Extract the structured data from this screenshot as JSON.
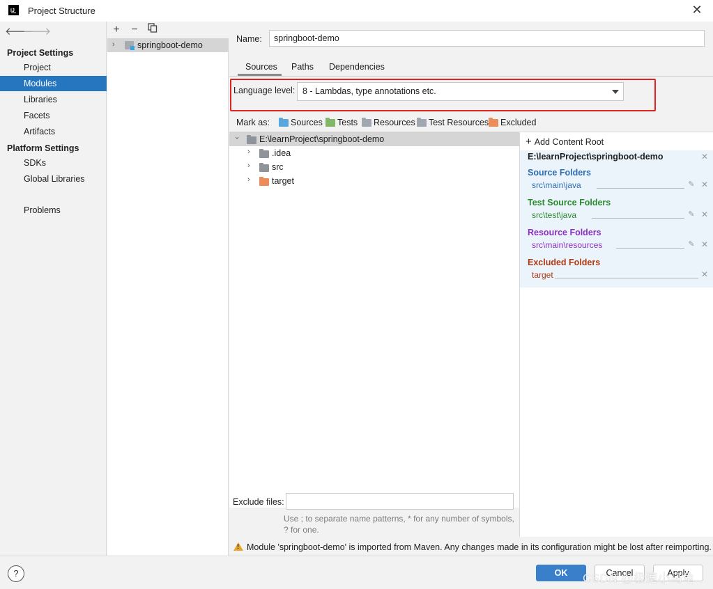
{
  "window": {
    "title": "Project Structure",
    "app_icon_text": "IJ"
  },
  "nav": {
    "back_icon": "arrow-left-icon",
    "forward_icon": "arrow-right-icon",
    "project_settings_heading": "Project Settings",
    "project_items": [
      "Project",
      "Modules",
      "Libraries",
      "Facets",
      "Artifacts"
    ],
    "selected": "Modules",
    "platform_settings_heading": "Platform Settings",
    "platform_items": [
      "SDKs",
      "Global Libraries"
    ],
    "problems": "Problems"
  },
  "modules": {
    "toolbar": {
      "add": "+",
      "remove": "−",
      "copy_icon": "copy-icon"
    },
    "items": [
      "springboot-demo"
    ]
  },
  "module": {
    "name_label": "Name:",
    "name_value": "springboot-demo",
    "tabs": [
      "Sources",
      "Paths",
      "Dependencies"
    ],
    "active_tab": "Sources",
    "language_level_label": "Language level:",
    "language_level_value": "8 - Lambdas, type annotations etc.",
    "mark_as_label": "Mark as:",
    "mark_as": [
      {
        "label": "Sources",
        "color": "#5aa7dd"
      },
      {
        "label": "Tests",
        "color": "#82b76a"
      },
      {
        "label": "Resources",
        "color": "#a0a7b0"
      },
      {
        "label": "Test Resources",
        "color": "#a0a7b0"
      },
      {
        "label": "Excluded",
        "color": "#eb8c5a"
      }
    ],
    "tree": {
      "root": "E:\\learnProject\\springboot-demo",
      "children": [
        ".idea",
        "src",
        "target"
      ]
    },
    "content_root": {
      "add_label": "Add Content Root",
      "path": "E:\\learnProject\\springboot-demo",
      "source_folders_label": "Source Folders",
      "source_folders": [
        "src\\main\\java"
      ],
      "test_source_folders_label": "Test Source Folders",
      "test_source_folders": [
        "src\\test\\java"
      ],
      "resource_folders_label": "Resource Folders",
      "resource_folders": [
        "src\\main\\resources"
      ],
      "excluded_folders_label": "Excluded Folders",
      "excluded_folders": [
        "target"
      ],
      "colors": {
        "source": "#2f6db3",
        "test": "#2a8a2e",
        "resource": "#8a2fc4",
        "excluded": "#b03a12"
      }
    },
    "exclude_files_label": "Exclude files:",
    "exclude_files_value": "",
    "exclude_hint": "Use ; to separate name patterns, * for any number of symbols, ? for one.",
    "warning": "Module 'springboot-demo' is imported from Maven. Any changes made in its configuration might be lost after reimporting."
  },
  "buttons": {
    "help": "?",
    "ok": "OK",
    "cancel": "Cancel",
    "apply": "Apply"
  },
  "watermark": "CSDN @极速小乌龟"
}
